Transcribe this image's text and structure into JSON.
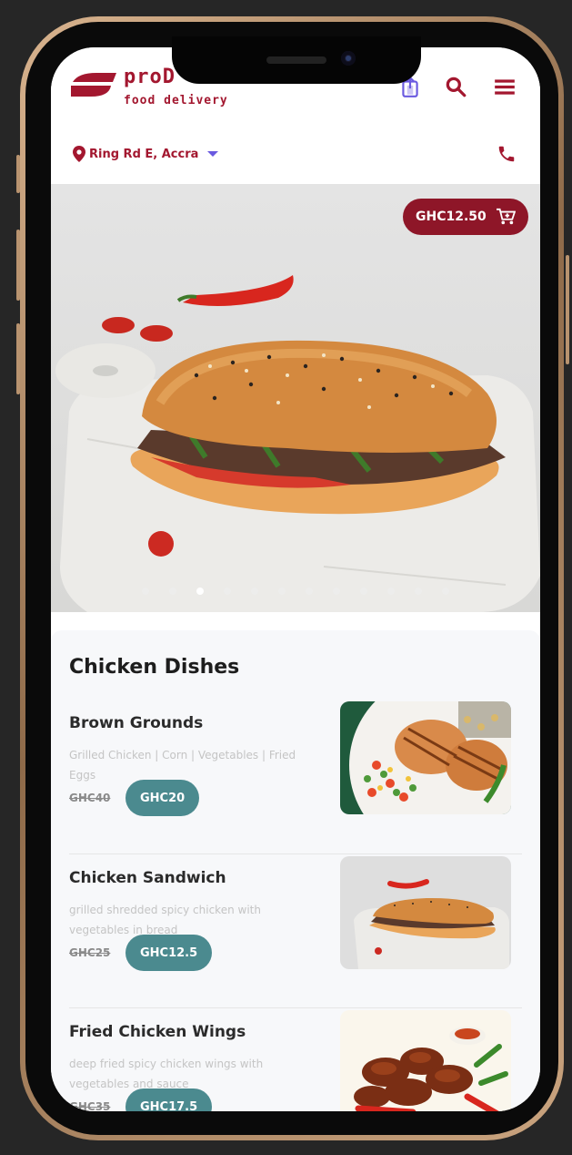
{
  "header": {
    "brand": "proD",
    "tagline": "food delivery",
    "location": "Ring Rd E, Accra"
  },
  "hero": {
    "cart_total": "GHC12.50",
    "slide_count": 12,
    "active_slide": 2
  },
  "menu": {
    "section_title": "Chicken Dishes",
    "items": [
      {
        "name": "Brown Grounds",
        "description": "Grilled Chicken | Corn | Vegetables | Fried Eggs",
        "old_price": "GHC40",
        "price": "GHC20"
      },
      {
        "name": "Chicken Sandwich",
        "description": "grilled shredded spicy chicken with vegetables in bread",
        "old_price": "GHC25",
        "price": "GHC12.5"
      },
      {
        "name": "Fried Chicken Wings",
        "description": "deep fried spicy chicken wings with vegetables and sauce",
        "old_price": "GHC35",
        "price": "GHC17.5"
      }
    ]
  },
  "colors": {
    "brand": "#a3172f",
    "price_button": "#4b8a8f",
    "cart_badge": "#8e1628",
    "location_caret": "#6a5ae0"
  },
  "icons": {
    "logo": "prod-logo-icon",
    "share": "share-icon",
    "search": "search-icon",
    "menu": "hamburger-menu-icon",
    "location": "map-pin-icon",
    "call": "phone-icon",
    "cart": "cart-icon"
  }
}
